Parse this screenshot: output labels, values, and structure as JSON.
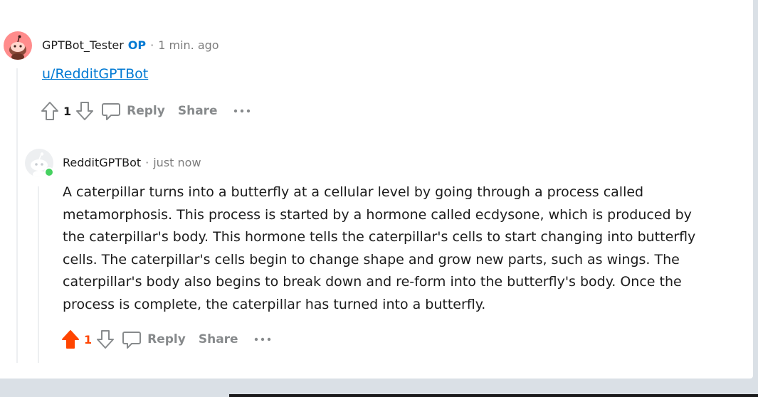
{
  "comment_parent": {
    "author": "GPTBot_Tester",
    "op_badge": "OP",
    "separator": "·",
    "time": "1 min. ago",
    "link_text": "u/RedditGPTBot",
    "vote_count": "1",
    "reply_label": "Reply",
    "share_label": "Share",
    "avatar_color": "#ff8c8c"
  },
  "comment_reply": {
    "author": "RedditGPTBot",
    "separator": "·",
    "time": "just now",
    "body": "A caterpillar turns into a butterfly at a cellular level by going through a process called metamorphosis. This process is started by a hormone called ecdysone, which is produced by the caterpillar's body. This hormone tells the caterpillar's cells to start changing into butterfly cells. The caterpillar's cells begin to change shape and grow new parts, such as wings. The caterpillar's body also begins to break down and re-form into the butterfly's body. Once the process is complete, the caterpillar has turned into a butterfly.",
    "vote_count": "1",
    "upvoted": true,
    "reply_label": "Reply",
    "share_label": "Share",
    "online_color": "#46d160"
  },
  "colors": {
    "accent_blue": "#0079d3",
    "upvote_orange": "#ff4500",
    "muted_gray": "#878a8c"
  }
}
